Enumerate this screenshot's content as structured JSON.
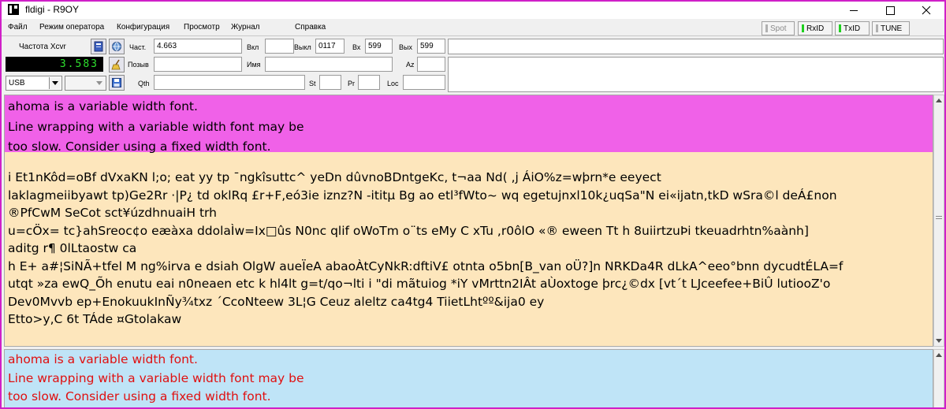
{
  "window": {
    "title": "fldigi - R9OY",
    "frame_color": "#d020c8"
  },
  "menu": {
    "items": [
      "Файл",
      "Режим оператора",
      "Конфигурация",
      "Просмотр",
      "Журнал",
      "Справка"
    ]
  },
  "status_buttons": {
    "spot": "Spot",
    "rxid": "RxID",
    "txid": "TxID",
    "tune": "TUNE",
    "led_on_color": "#1ed01e"
  },
  "rig": {
    "xcvr_label": "Частота Xcvr",
    "freq_display": "3.583",
    "mode": "USB",
    "bandwidth": ""
  },
  "log_fields": {
    "freq_label": "Част.",
    "freq_value": "4.663",
    "on_label": "Вкл",
    "on_value": "",
    "off_label": "Выкл",
    "off_value": "0117",
    "in_label": "Вх",
    "in_value": "599",
    "out_label": "Вых",
    "out_value": "599",
    "call_label": "Позыв",
    "call_value": "",
    "name_label": "Имя",
    "name_value": "",
    "az_label": "Az",
    "az_value": "",
    "qth_label": "Qth",
    "qth_value": "",
    "st_label": "St",
    "st_value": "",
    "pr_label": "Pr",
    "pr_value": "",
    "loc_label": "Loc",
    "loc_value": ""
  },
  "icons": {
    "tool1": "notebook-icon",
    "tool2": "globe-icon",
    "tool3": "broom-icon",
    "tool4": "save-icon"
  },
  "receive": {
    "background": "#fde6bc",
    "warning_background": "#f061e8",
    "warning_lines": [
      "ahoma is a variable width font.",
      "Line wrapping with a variable width font may be",
      "too slow. Consider using a fixed width font."
    ],
    "text_lines": [
      "i Et1nKôd=oBf dVxaKN l;o; eat  yy tp ¯ngkîsuttc^ yeDn  dûvnoBDntgeKc, t¬aa Nd( ,j ÁiO%z=wþrn*e eeyect",
      "laklagmeiibyawt tp)Ge2Rr ·|P¿ td oklRq £r+F,eó3ie  iznz?N -ititµ Bg ao etl³fWto~ wq egetujnxl10k¿uqSa\"N ei«ijatn,tkD   wSra©l deÁ£non",
      "®PfCwM SeCot sct¥úzdhnuaiH trh",
      "u=cÖx= tc}ahSreoc¢o eæàxa  ddolaÌw=Ix□ûs N0nc   qlif oWoTm o¨ts eMy C xTu  ,r0ôlO «® eween Tt h 8uiirtzuÞi tkeuadrhtn%aành]",
      "aditg r¶  0lLtaostw ca",
      "h E+  a#¦SiNÃ+tfel M ng%irva e dsiah OlgW aueÏeA abaoÀtCyNkR:dftiV£ otnta o5bn[B_van oÜ?]n  NRKDa4R dLkA^eeo°bnn dycudtÉLA=f",
      "utqt »za ewQ_Õh  enutu eai  n0neaen  etc k hl4lt g=t/qo¬lti i \"di mãtuiog *iY vMrttn2IÂt aÙoxtoge þrc¿©dx [vt´t LJceefee+BiÛ lutiooZ'o",
      "Dev0Mvvb  ep+EnokuukInÑy¾txz  ´CcoNteew 3L¦G Ceuz aleltz ca4tg4 TiietLhtºº&ija0 ey",
      "Etto>y,C 6t TÁde ¤Gtolakaw"
    ]
  },
  "transmit": {
    "background": "#bfe4f7",
    "text_color": "#e01010",
    "lines": [
      "ahoma is a variable width font.",
      "Line wrapping with a variable width font may be",
      "too slow. Consider using a fixed width font."
    ]
  }
}
